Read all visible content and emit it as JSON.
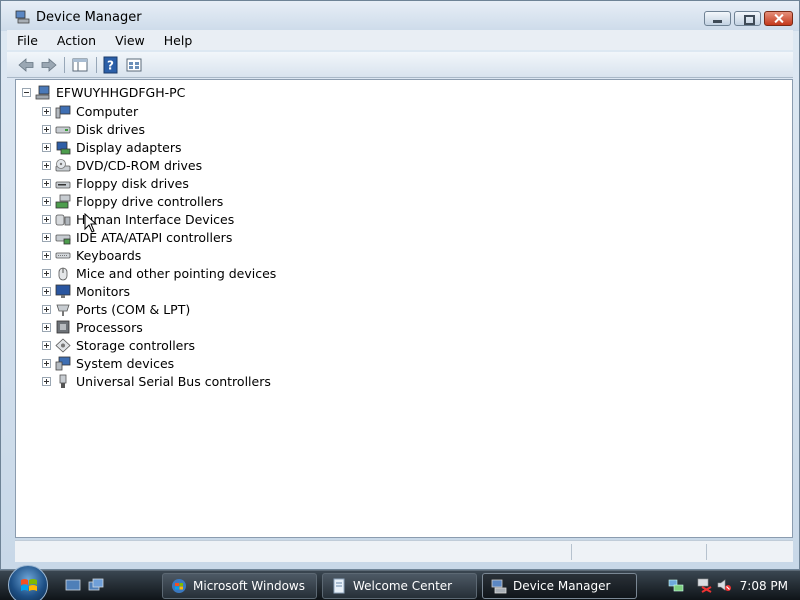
{
  "window": {
    "title": "Device Manager",
    "title_icon": "device-manager-icon"
  },
  "menu": [
    "File",
    "Action",
    "View",
    "Help"
  ],
  "toolbar": {
    "buttons": [
      {
        "name": "back-arrow-icon"
      },
      {
        "name": "forward-arrow-icon"
      },
      {
        "name": "properties-pane-icon"
      },
      {
        "name": "help-icon"
      },
      {
        "name": "view-icon"
      }
    ]
  },
  "tree": {
    "root": {
      "label": "EFWUYHHGDFGH-PC",
      "icon": "computer-icon",
      "expanded": true
    },
    "children": [
      {
        "label": "Computer",
        "icon": "computer-icon"
      },
      {
        "label": "Disk drives",
        "icon": "disk-drive-icon"
      },
      {
        "label": "Display adapters",
        "icon": "display-adapter-icon"
      },
      {
        "label": "DVD/CD-ROM drives",
        "icon": "dvd-drive-icon"
      },
      {
        "label": "Floppy disk drives",
        "icon": "floppy-drive-icon"
      },
      {
        "label": "Floppy drive controllers",
        "icon": "floppy-controller-icon"
      },
      {
        "label": "Human Interface Devices",
        "icon": "hid-icon"
      },
      {
        "label": "IDE ATA/ATAPI controllers",
        "icon": "ide-controller-icon"
      },
      {
        "label": "Keyboards",
        "icon": "keyboard-icon"
      },
      {
        "label": "Mice and other pointing devices",
        "icon": "mouse-icon"
      },
      {
        "label": "Monitors",
        "icon": "monitor-icon"
      },
      {
        "label": "Ports (COM & LPT)",
        "icon": "port-icon"
      },
      {
        "label": "Processors",
        "icon": "processor-icon"
      },
      {
        "label": "Storage controllers",
        "icon": "storage-controller-icon"
      },
      {
        "label": "System devices",
        "icon": "system-devices-icon"
      },
      {
        "label": "Universal Serial Bus controllers",
        "icon": "usb-icon"
      }
    ]
  },
  "taskbar": {
    "tasks": [
      {
        "label": "Microsoft Windows",
        "icon": "windows-icon",
        "active": false
      },
      {
        "label": "Welcome Center",
        "icon": "document-icon",
        "active": false
      },
      {
        "label": "Device Manager",
        "icon": "device-manager-icon",
        "active": true
      }
    ],
    "clock": "7:08 PM"
  },
  "colors": {
    "accent": "#1d4f85",
    "window_frame": "#c8d8e8",
    "taskbar": "#1a2027"
  }
}
